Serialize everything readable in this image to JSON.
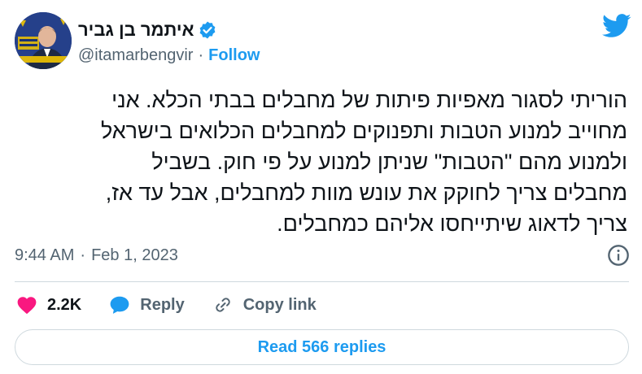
{
  "author": {
    "name": "איתמר בן גביר",
    "handle": "@itamarbengvir",
    "follow_label": "Follow"
  },
  "tweet": {
    "lines": [
      "הוריתי לסגור מאפיות פיתות של מחבלים בבתי הכלא. אני",
      "מחוייב למנוע הטבות ותפנוקים למחבלים הכלואים בישראל",
      "ולמנוע מהם \"הטבות\" שניתן למנוע על פי חוק. בשביל",
      "מחבלים צריך לחוקק את עונש מוות למחבלים, אבל עד אז,",
      "צריך לדאוג שיתייחסו אליהם כמחבלים."
    ],
    "time": "9:44 AM",
    "separator": "·",
    "date": "Feb 1, 2023"
  },
  "actions": {
    "likes": "2.2K",
    "reply_label": "Reply",
    "copy_link_label": "Copy link"
  },
  "read_replies_label": "Read 566 replies",
  "colors": {
    "brand_blue": "#1d9bf0",
    "like_pink": "#f91880",
    "muted_text": "#536471",
    "divider": "#cfd9de"
  },
  "icons": [
    "verified-badge-icon",
    "twitter-bird-icon",
    "info-icon",
    "heart-icon",
    "reply-bubble-icon",
    "link-icon"
  ]
}
